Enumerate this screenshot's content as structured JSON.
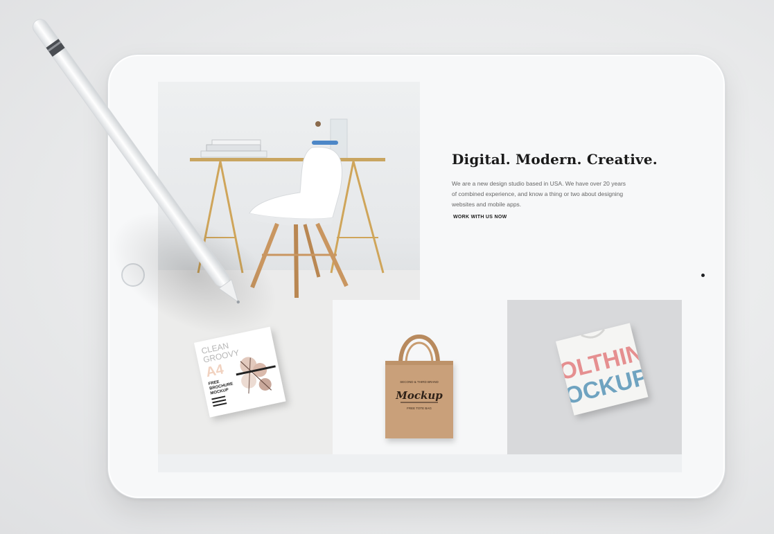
{
  "hero": {
    "headline": "Digital. Modern. Creative.",
    "intro": "We are a new design studio based in USA. We have over 20 years of combined experience, and know a thing or two about designing websites and mobile apps.",
    "cta_label": "WORK WITH US NOW"
  },
  "brochure": {
    "line1": "CLEAN",
    "line2": "GROOVY",
    "size": "A4",
    "sub1": "FREE",
    "sub2": "BROCHURE",
    "sub3": "MOCKUP"
  },
  "tote": {
    "top_text": "SECOND & THIRD BRAND",
    "script_text": "Mockup",
    "bottom_text": "FREE TOTE BAG"
  },
  "tshirt": {
    "line1": "OLTHIN",
    "line2": "OCKUP"
  },
  "colors": {
    "screen_bg": "#f4f5f6",
    "headline": "#1a1a1a",
    "body_text": "#666666",
    "tee_red": "#e58f90",
    "tee_blue": "#6fa3c0"
  },
  "icons": {
    "home_button": "home-button-icon",
    "camera": "camera-icon",
    "pencil": "stylus-pencil-icon"
  }
}
